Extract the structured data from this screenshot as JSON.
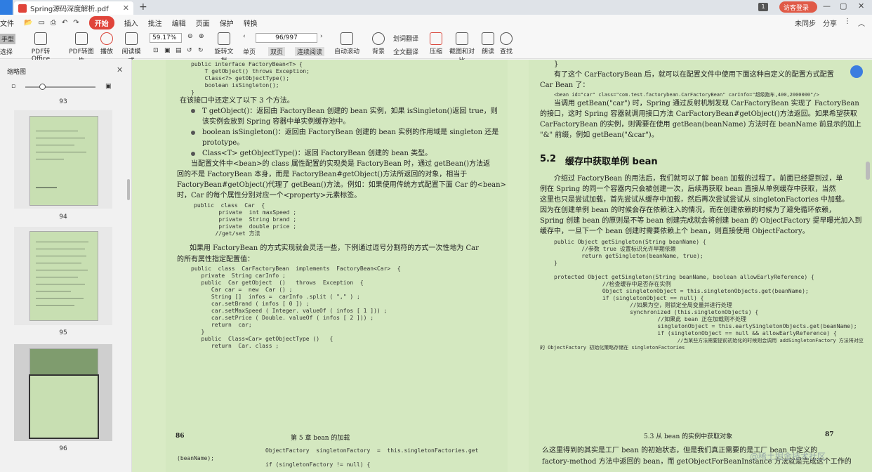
{
  "tabbar": {
    "tab_title": "Spring源码深度解析.pdf",
    "page_badge": "1",
    "login_label": "访客登录"
  },
  "menubar": {
    "file": "文件",
    "items": [
      "开始",
      "插入",
      "批注",
      "编辑",
      "页面",
      "保护",
      "转换"
    ],
    "right": [
      "未同步",
      "分享"
    ]
  },
  "ribbon": {
    "hand": "手型",
    "select": "选择",
    "pdf_office": "PDF转Office",
    "pdf_image": "PDF转图片",
    "play": "播放",
    "read_mode": "阅读模式",
    "zoom": "59.17%",
    "page_input": "96/997",
    "rotate": "旋转文档",
    "single": "单页",
    "double": "双页",
    "continuous": "连续阅读",
    "autoscroll": "自动滚动",
    "background": "背景",
    "word_translate": "划词翻译",
    "full_translate": "全文翻译",
    "compress": "压缩",
    "screenshot": "截图和对比",
    "read_aloud": "朗读",
    "search": "查找"
  },
  "sidebar": {
    "title": "缩略图",
    "pages": [
      "93",
      "94",
      "95",
      "96"
    ]
  },
  "left_page": {
    "code_top": [
      "public interface FactoryBean<T> {",
      "  T getObject() throws Exception;",
      "  Class<?> getObjectType();",
      "  boolean isSingleton();",
      "}"
    ],
    "intro": "在该接口中还定义了以下 3 个方法。",
    "bullet1a": "T getObject()：返回由 FactoryBean 创建的 bean 实例，如果 isSingleton()返回 true，则",
    "bullet1b": "该实例会放到 Spring 容器中单实例缓存池中。",
    "bullet2a": "boolean isSingleton()：返回由 FactoryBean 创建的 bean 实例的作用域是 singleton 还是",
    "bullet2b": "prototype。",
    "bullet3": "Class<T> getObjectType()：返回 FactoryBean 创建的 bean 类型。",
    "para1": "当配置文件中<bean>的 class 属性配置的实现类是 FactoryBean 时，通过 getBean()方法返",
    "para2": "回的不是 FactoryBean 本身，而是 FactoryBean#getObject()方法所返回的对象，相当于",
    "para3": "FactoryBean#getObject()代理了 getBean()方法。例如：如果使用传统方式配置下面 Car 的<bean>",
    "para4": "时，Car 的每个属性分别对应一个<property>元素标签。",
    "code_car": [
      "public  class  Car  {",
      "    private  int maxSpeed ;",
      "    private  String brand ;",
      "    private  double price ;",
      "   //get/set 方法"
    ],
    "para5": "如果用 FactoryBean 的方式实现就会灵活一些，下例通过逗号分割符的方式一次性地为 Car",
    "para6": "的所有属性指定配置值：",
    "code_factory": [
      "public  class  CarFactoryBean  implements  FactoryBean<Car>  {",
      "   private  String carInfo ;",
      "   public  Car getObject  ()   throws  Exception  {",
      "      Car car =  new  Car () ;",
      "      String []  infos =  carInfo .split ( \",\" ) ;",
      "      car.setBrand ( infos [ 0 ]) ;",
      "      car.setMaxSpeed ( Integer. valueOf ( infos [ 1 ])) ;",
      "      car.setPrice ( Double. valueOf ( infos [ 2 ])) ;",
      "      return  car;",
      "   }",
      "   public  Class<Car> getObjectType ()   {",
      "      return  Car. class ;"
    ],
    "footer_num": "86",
    "footer_title": "第 5 章   bean 的加载",
    "bottom_code1": "ObjectFactory  singletonFactory  =  this.singletonFactories.get",
    "bottom_code2": "(beanName);",
    "bottom_code3": "if (singletonFactory != null) {"
  },
  "right_page": {
    "top1": "}",
    "para1a": "有了这个 CarFactoryBean 后，就可以在配置文件中使用下面这种自定义的配置方式配置",
    "para1b": "Car Bean 了：",
    "xml": "<bean id=\"car\" class=\"com.test.factorybean.CarFactoryBean\" carInfo=\"超级跑车,400,2000000\"/>",
    "para2a": "当调用 getBean(\"car\") 时，Spring 通过反射机制发现 CarFactoryBean 实现了 FactoryBean",
    "para2b": "的接口，这时 Spring 容器就调用接口方法 CarFactoryBean#getObject()方法返回。如果希望获取",
    "para2c": "CarFactoryBean 的实例，则需要在使用 getBean(beanName) 方法时在 beanName 前显示的加上",
    "para2d": "\"&\" 前缀，例如 getBean(\"&car\")。",
    "section_num": "5.2",
    "section_title": "缓存中获取单例 bean",
    "p3a": "介绍过 FactoryBean 的用法后，我们就可以了解 bean 加载的过程了。前面已经提到过，单",
    "p3b": "例在 Spring 的同一个容器内只会被创建一次，后续再获取 bean 直接从单例缓存中获取，当然",
    "p3c": "这里也只是尝试加载，首先尝试从缓存中加载，然后再次尝试尝试从 singletonFactories 中加载。",
    "p3d": "因为在创建单例 bean 的时候会存在依赖注入的情况，而在创建依赖的时候为了避免循环依赖，",
    "p3e": "Spring 创建 bean 的原则是不等 bean 创建完成就会将创建 bean 的 ObjectFactory 提早曝光加入到",
    "p3f": "缓存中，一旦下一个 bean 创建时需要依赖上个 bean，则直接使用 ObjectFactory。",
    "code1": [
      "public Object getSingleton(String beanName) {",
      "    //参数 true 设置标识允许早期依赖",
      "    return getSingleton(beanName, true);",
      "}"
    ],
    "code2": [
      "protected Object getSingleton(String beanName, boolean allowEarlyReference) {",
      "      //检查缓存中是否存在实例",
      "      Object singletonObject = this.singletonObjects.get(beanName);",
      "      if (singletonObject == null) {",
      "          //如果为空，则锁定全局变量并进行处理",
      "          synchronized (this.singletonObjects) {",
      "              //如果此 bean 正在加载则不处理",
      "              singletonObject = this.earlySingletonObjects.get(beanName);",
      "              if (singletonObject == null && allowEarlyReference) {",
      "                  //当某些方法需要提前初始化的时候则会调用 addSingletonFactory 方法将对应",
      "的 ObjectFactory 初始化策略存储在 singletonFactories"
    ],
    "footer_section": "5.3   从 bean 的实例中获取对象",
    "footer_num": "87",
    "bottom1": "么这里得到的其实是工厂 bean 的初始状态，但是我们真正需要的是工厂 bean 中定义的",
    "bottom2": "factory-method 方法中返回的 bean，而 getObjectForBeanInstance 方法就是完成这个工作的"
  },
  "watermark": "@稀土掘金技术社区"
}
